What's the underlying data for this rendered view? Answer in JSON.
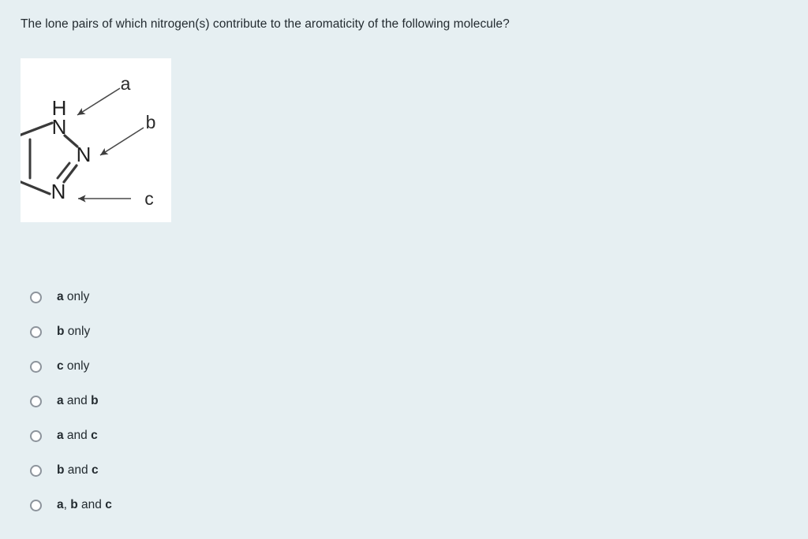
{
  "question": {
    "prompt": "The lone pairs of which nitrogen(s) contribute to the aromaticity of the following molecule?"
  },
  "molecule": {
    "name": "1H-1,2,3-triazole",
    "atom_labels": {
      "hydrogen": "H",
      "nitrogen_1": "N",
      "nitrogen_2": "N",
      "nitrogen_3": "N"
    },
    "annotations": [
      {
        "id": "a",
        "label": "a",
        "points_to": "nitrogen_1_NH"
      },
      {
        "id": "b",
        "label": "b",
        "points_to": "nitrogen_2"
      },
      {
        "id": "c",
        "label": "c",
        "points_to": "nitrogen_3"
      }
    ],
    "colors": {
      "bond": "#3a3a3a",
      "atom_text": "#1f1f1f",
      "annotation_text": "#2b2b2b",
      "arrow": "#4a4a4a",
      "card_background": "#ffffff"
    }
  },
  "options": [
    {
      "id": "opt-a-only",
      "bold_prefix": "a",
      "rest": " only",
      "selected": false
    },
    {
      "id": "opt-b-only",
      "bold_prefix": "b",
      "rest": " only",
      "selected": false
    },
    {
      "id": "opt-c-only",
      "bold_prefix": "c",
      "rest": " only",
      "selected": false
    },
    {
      "id": "opt-a-and-b",
      "bold_prefix": "a",
      "rest": " and ",
      "bold_suffix": "b",
      "selected": false
    },
    {
      "id": "opt-a-and-c",
      "bold_prefix": "a",
      "rest": " and ",
      "bold_suffix": "c",
      "selected": false
    },
    {
      "id": "opt-b-and-c",
      "bold_prefix": "b",
      "rest": " and ",
      "bold_suffix": "c",
      "selected": false
    },
    {
      "id": "opt-a-b-and-c",
      "bold_prefix": "a",
      "rest": ", ",
      "bold_mid": "b",
      "rest2": " and ",
      "bold_suffix": "c",
      "selected": false
    }
  ],
  "options_plain": [
    "a only",
    "b only",
    "c only",
    "a and b",
    "a and c",
    "b and c",
    "a, b and c"
  ],
  "theme": {
    "page_background": "#e6eff2",
    "text_color": "#232b30",
    "radio_border": "#8d949c",
    "radio_fill": "#ffffff"
  }
}
